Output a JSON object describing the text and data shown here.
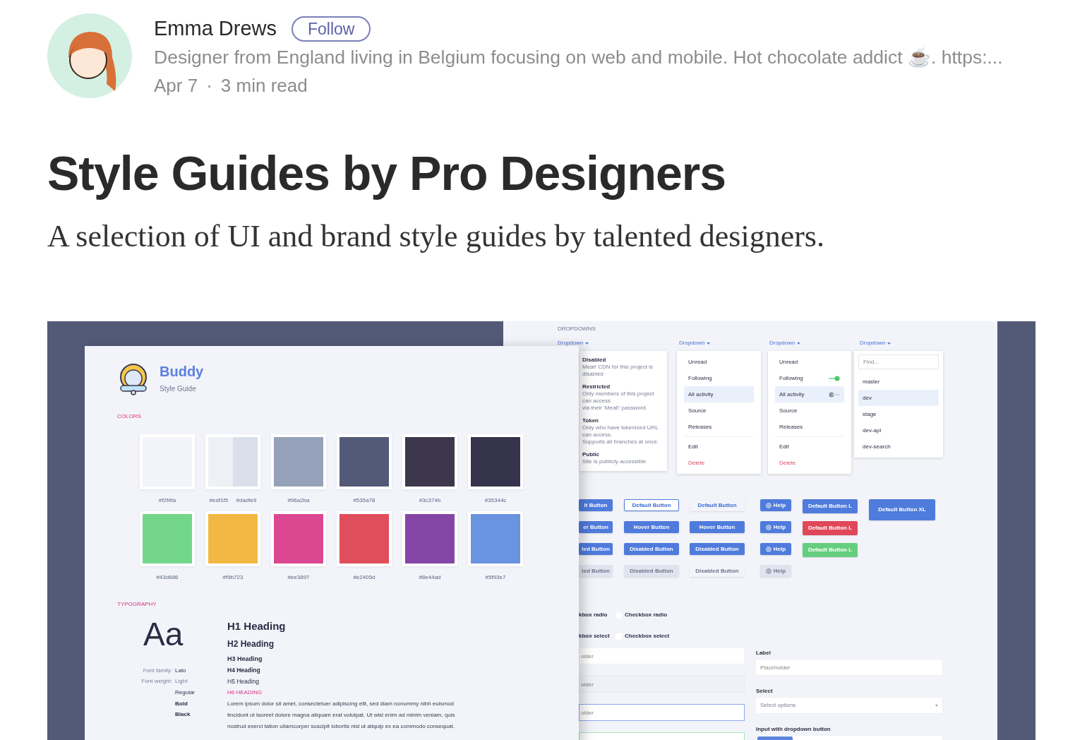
{
  "author": {
    "name": "Emma Drews",
    "follow_button": "Follow",
    "bio": "Designer from England living in Belgium focusing on web and mobile. Hot chocolate addict ☕. https:...",
    "date": "Apr 7",
    "separator": "·",
    "read_time": "3 min read"
  },
  "article": {
    "title": "Style Guides by Pro Designers",
    "subtitle": "A selection of UI and brand style guides by talented designers."
  },
  "image": {
    "front_card": {
      "brand": "Buddy",
      "tagline": "Style Guide",
      "colors_heading": "COLORS",
      "swatches": [
        {
          "parts": [
            {
              "color": "#f2f4fa",
              "label": "#f2f4fa"
            }
          ]
        },
        {
          "parts": [
            {
              "color": "#edf1f5",
              "label": "#edf1f5"
            },
            {
              "color": "#dadfe9",
              "label": "#dadfe9"
            }
          ]
        },
        {
          "parts": [
            {
              "color": "#96a2ba",
              "label": "#96a2ba"
            }
          ]
        },
        {
          "parts": [
            {
              "color": "#535a78",
              "label": "#535a78"
            }
          ]
        },
        {
          "parts": [
            {
              "color": "#3c374b",
              "label": "#3c374b"
            }
          ]
        },
        {
          "parts": [
            {
              "color": "#35344c",
              "label": "#35344c"
            }
          ]
        },
        {
          "parts": [
            {
              "color": "#73d68a",
              "label": "#43d686"
            }
          ]
        },
        {
          "parts": [
            {
              "color": "#f2b843",
              "label": "#f9b723"
            }
          ]
        },
        {
          "parts": [
            {
              "color": "#dc4792",
              "label": "#ee3897"
            }
          ]
        },
        {
          "parts": [
            {
              "color": "#e04e5b",
              "label": "#e2405d"
            }
          ]
        },
        {
          "parts": [
            {
              "color": "#8446a6",
              "label": "#8e44ad"
            }
          ]
        },
        {
          "parts": [
            {
              "color": "#6a93e0",
              "label": "#5f93e7"
            }
          ]
        }
      ],
      "typography_heading": "TYPOGRAPHY",
      "sample": "Aa",
      "font_props": [
        {
          "label": "Font family:",
          "values": [
            "Lato"
          ]
        },
        {
          "label": "Font weight:",
          "values": [
            "Light",
            "Regular",
            "Bold",
            "Black"
          ]
        }
      ],
      "headings": [
        "H1 Heading",
        "H2 Heading",
        "H3 Heading",
        "H4 Heading",
        "H5 Heading",
        "H6 HEADING"
      ],
      "paragraph_lines": [
        "Lorem ipsum dolor sit amet, consectetuer adipiscing elit, sed diam nonummy nibh euismod",
        "tincidunt ut laoreet dolore magna aliquam erat volutpat. Ut wisi enim ad minim veniam, quis",
        "nostrud exerci tation ullamcorper suscipit lobortis nisl ut aliquip ex ea commodo consequat."
      ]
    },
    "back_panel": {
      "section_heading": "DROPDOWNS",
      "dropdowns": [
        {
          "kind": "described",
          "trigger": "Dropdown",
          "items": [
            {
              "title": "Disabled",
              "description": [
                "Meat! CDN for this project is disabled"
              ]
            },
            {
              "title": "Restricted",
              "description": [
                "Only members of this project can access",
                "via their 'Meat!' password."
              ]
            },
            {
              "title": "Token",
              "description": [
                "Only who have tokenized URL can access.",
                "Supports all branches at once."
              ]
            },
            {
              "title": "Public",
              "description": [
                "Site is publicly accessible"
              ]
            }
          ]
        },
        {
          "kind": "plain",
          "trigger": "Dropdown",
          "sections": [
            [
              {
                "label": "Unread",
                "selected": false
              },
              {
                "label": "Following",
                "selected": false
              },
              {
                "label": "All activity",
                "selected": true
              },
              {
                "label": "Source",
                "selected": false
              },
              {
                "label": "Releases",
                "selected": false
              }
            ],
            [
              {
                "label": "Edit",
                "selected": false,
                "danger": false
              },
              {
                "label": "Delete",
                "selected": false,
                "danger": true
              }
            ]
          ]
        },
        {
          "kind": "toggles",
          "trigger": "Dropdown",
          "sections": [
            [
              {
                "label": "Unread",
                "selected": false
              },
              {
                "label": "Following",
                "selected": false,
                "on": true
              },
              {
                "label": "All activity",
                "selected": true,
                "on": false
              },
              {
                "label": "Source",
                "selected": false
              },
              {
                "label": "Releases",
                "selected": false
              }
            ],
            [
              {
                "label": "Edit",
                "selected": false,
                "danger": false
              },
              {
                "label": "Delete",
                "selected": false,
                "danger": true
              }
            ]
          ]
        },
        {
          "kind": "search",
          "trigger": "Dropdown",
          "placeholder": "Find...",
          "items": [
            {
              "label": "master",
              "selected": false
            },
            {
              "label": "dev",
              "selected": true
            },
            {
              "label": "stage",
              "selected": false
            },
            {
              "label": "dev-api",
              "selected": false
            },
            {
              "label": "dev-search",
              "selected": false
            }
          ]
        }
      ],
      "button_columns": [
        [
          {
            "label": "lt Button",
            "kind": "filled"
          },
          {
            "label": "er Button",
            "kind": "filled"
          },
          {
            "label": "led Button",
            "kind": "filled"
          },
          {
            "label": "led Button",
            "kind": "disabled"
          }
        ],
        [
          {
            "label": "Default Button",
            "kind": "outline"
          },
          {
            "label": "Hover Button",
            "kind": "filled"
          },
          {
            "label": "Disabled Button",
            "kind": "filled"
          },
          {
            "label": "Disabled Button",
            "kind": "disabled"
          }
        ],
        [
          {
            "label": "Default Button",
            "kind": "text"
          },
          {
            "label": "Hover Button",
            "kind": "filled"
          },
          {
            "label": "Disabled Button",
            "kind": "filled"
          },
          {
            "label": "Disabled Button",
            "kind": "ghost"
          }
        ],
        [
          {
            "label": "Help",
            "kind": "filled"
          },
          {
            "label": "Help",
            "kind": "filled"
          },
          {
            "label": "Help",
            "kind": "filled"
          },
          {
            "label": "Help",
            "kind": "disabled"
          }
        ],
        [
          {
            "label": "Default Button L",
            "kind": "filled"
          },
          {
            "label": "Default Button L",
            "kind": "danger"
          },
          {
            "label": "Default Button L",
            "kind": "success"
          }
        ],
        [
          {
            "label": "Default Button XL",
            "kind": "filled"
          }
        ]
      ],
      "choices": [
        {
          "kind": "radio",
          "cut_label": "kbox radio",
          "label": "Checkbox radio",
          "checked": false
        },
        {
          "kind": "checkbox",
          "cut_label": "kbox select",
          "label": "Checkbox select",
          "checked": false
        }
      ],
      "inputs": [
        {
          "kind": "default",
          "placeholder": "older"
        },
        {
          "kind": "disabled",
          "placeholder": "older"
        },
        {
          "kind": "focus",
          "placeholder": "older"
        },
        {
          "kind": "success"
        }
      ],
      "form": [
        {
          "kind": "input",
          "label": "Label",
          "placeholder": "Placeholder"
        },
        {
          "kind": "select",
          "label": "Select",
          "placeholder": "Select options"
        },
        {
          "kind": "input-dropdown",
          "label": "Input with dropdown button"
        }
      ]
    }
  }
}
